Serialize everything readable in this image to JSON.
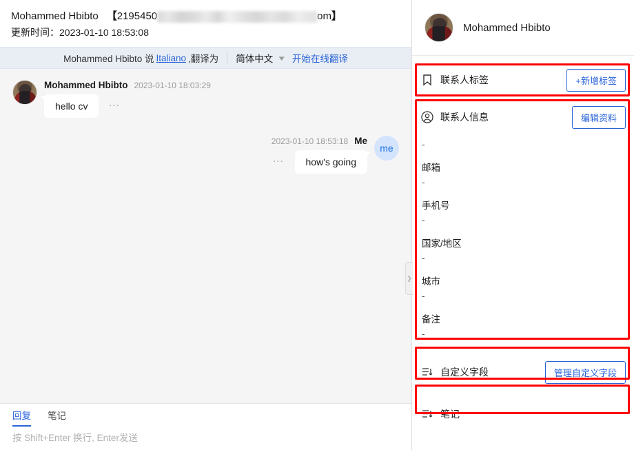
{
  "chat": {
    "header": {
      "peer_name": "Mohammed Hbibto",
      "bracket_open": "【",
      "mail_head": "2195450",
      "mail_tail": "om",
      "bracket_close": "】",
      "update_line": "更新时间：2023-01-10 18:53:08"
    },
    "translate_bar": {
      "prefix": "Mohammed Hbibto 说",
      "source_language": "Italiano",
      "middle": ",翻译为",
      "target_language": "简体中文",
      "chevron_icon": "chevron-down-icon",
      "start_link": "开始在线翻译"
    },
    "messages": [
      {
        "direction": "incoming",
        "sender": "Mohammed Hbibto",
        "timestamp": "2023-01-10 18:03:29",
        "text": "hello cv",
        "more_icon": "ellipsis-icon",
        "avatar_name": "contact-avatar"
      },
      {
        "direction": "outgoing",
        "sender": "Me",
        "timestamp": "2023-01-10 18:53:18",
        "text": "how's going",
        "more_icon": "ellipsis-icon",
        "avatar_label": "me"
      }
    ],
    "composer": {
      "tabs": [
        {
          "label": "回复",
          "active": true
        },
        {
          "label": "笔记",
          "active": false
        }
      ],
      "placeholder": "按 Shift+Enter 换行, Enter发送"
    },
    "collapse_handle_icon": "chevron-right-icon"
  },
  "info_panel": {
    "profile": {
      "name": "Mohammed Hbibto",
      "avatar_name": "contact-avatar"
    },
    "sections": [
      {
        "key": "tags",
        "icon": "bookmark-icon",
        "title": "联系人标签",
        "action_label": "+新增标签",
        "highlighted": true
      },
      {
        "key": "contact_info",
        "icon": "user-circle-icon",
        "title": "联系人信息",
        "action_label": "编辑资料",
        "highlighted": true,
        "fields": [
          {
            "label": "",
            "value": "-"
          },
          {
            "label": "邮箱",
            "value": "-"
          },
          {
            "label": "手机号",
            "value": "-"
          },
          {
            "label": "国家/地区",
            "value": "-"
          },
          {
            "label": "城市",
            "value": "-"
          },
          {
            "label": "备注",
            "value": "-"
          }
        ]
      },
      {
        "key": "custom_fields",
        "icon": "form-list-icon",
        "title": "自定义字段",
        "action_label": "管理自定义字段",
        "highlighted": true
      },
      {
        "key": "notes",
        "icon": "form-list-icon",
        "title": "笔记",
        "action_label": "",
        "highlighted": true
      }
    ]
  },
  "colors": {
    "accent_blue": "#2a64d8",
    "annotation_red": "#ff0000",
    "translate_bar_bg": "#e9eef5",
    "chat_bg": "#f5f5f5",
    "me_avatar_bg": "#d4e4fd"
  }
}
